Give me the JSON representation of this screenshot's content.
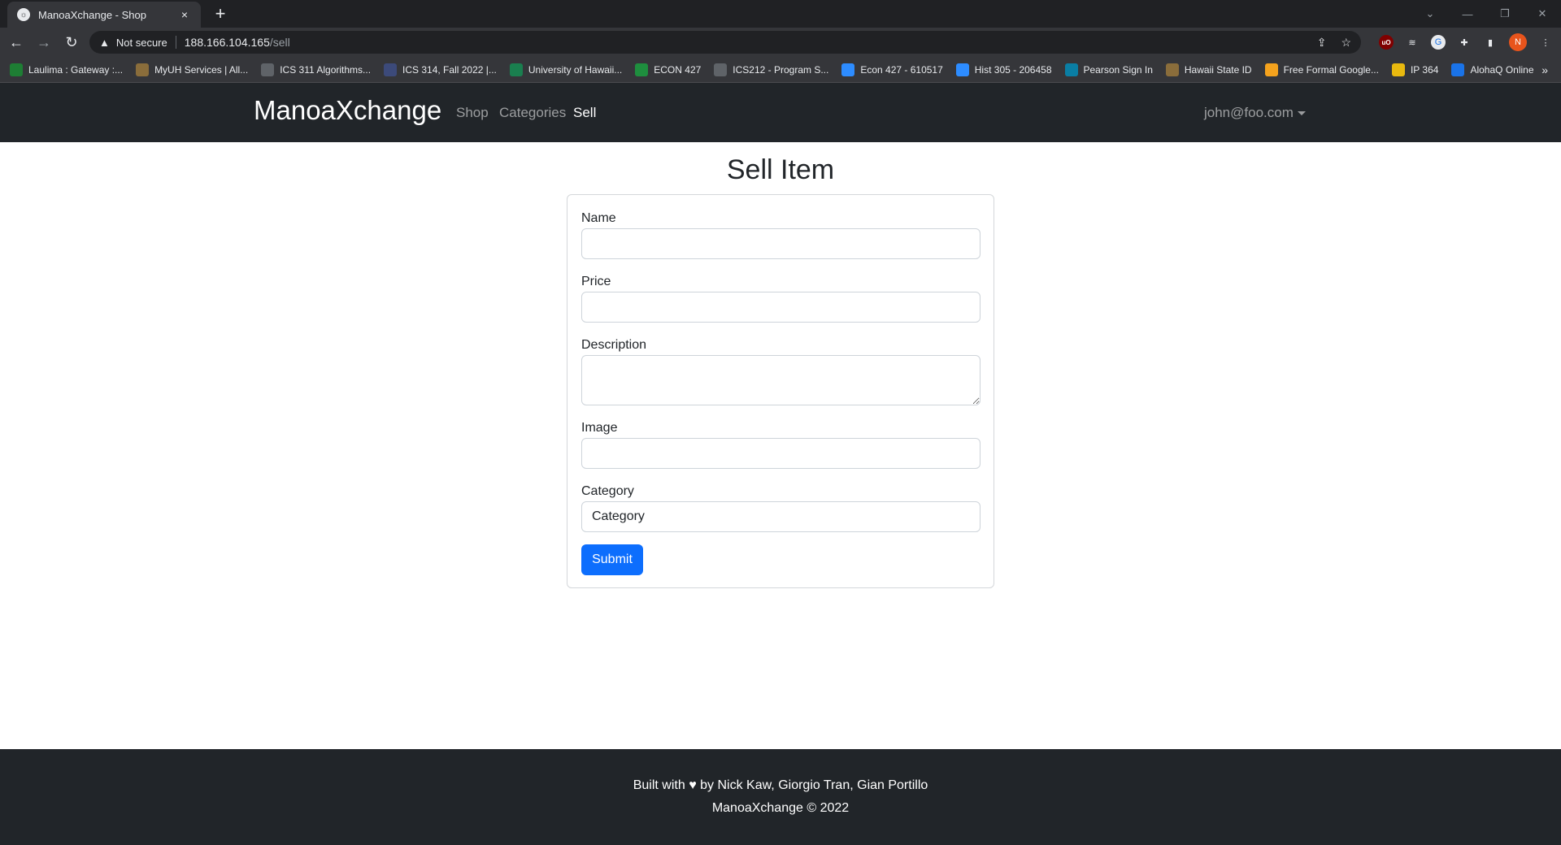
{
  "browser": {
    "tab_title": "ManoaXchange - Shop",
    "tab_close": "×",
    "new_tab": "+",
    "not_secure": "Not secure",
    "url_host": "188.166.104.165",
    "url_path": "/sell",
    "profile_initial": "N",
    "bookmarks": [
      {
        "label": "Laulima : Gateway :...",
        "icon": "laulima-icon",
        "color": "#1e7e34"
      },
      {
        "label": "MyUH Services | All...",
        "icon": "uh-icon",
        "color": "#8a6d3b"
      },
      {
        "label": "ICS 311 Algorithms...",
        "icon": "globe-icon",
        "color": "#5f6368"
      },
      {
        "label": "ICS 314, Fall 2022 |...",
        "icon": "page-icon",
        "color": "#3c4a7a"
      },
      {
        "label": "University of Hawaii...",
        "icon": "uh-seal-icon",
        "color": "#1a7f4f"
      },
      {
        "label": "ECON 427",
        "icon": "classroom-icon",
        "color": "#1e8e3e"
      },
      {
        "label": "ICS212 - Program S...",
        "icon": "globe-icon",
        "color": "#5f6368"
      },
      {
        "label": "Econ 427 - 610517",
        "icon": "zoom-icon",
        "color": "#2d8cff"
      },
      {
        "label": "Hist 305 - 206458",
        "icon": "zoom-icon",
        "color": "#2d8cff"
      },
      {
        "label": "Pearson Sign In",
        "icon": "pearson-icon",
        "color": "#0a7ea4"
      },
      {
        "label": "Hawaii State ID",
        "icon": "seal-icon",
        "color": "#8a6d3b"
      },
      {
        "label": "Free Formal Google...",
        "icon": "bookmark-icon",
        "color": "#f4a21d"
      },
      {
        "label": "IP 364",
        "icon": "classroom-icon",
        "color": "#e8b90f"
      },
      {
        "label": "AlohaQ Online",
        "icon": "search-icon",
        "color": "#1a73e8"
      }
    ]
  },
  "nav": {
    "brand": "ManoaXchange",
    "links": [
      "Shop",
      "Categories",
      "Sell"
    ],
    "user": "john@foo.com"
  },
  "form": {
    "title": "Sell Item",
    "name_label": "Name",
    "price_label": "Price",
    "description_label": "Description",
    "image_label": "Image",
    "category_label": "Category",
    "category_value": "Category",
    "submit_label": "Submit"
  },
  "footer": {
    "built_with": "Built with",
    "heart": "♥",
    "authors": "by Nick Kaw,  Giorgio Tran,  Gian Portillo",
    "copyright": "ManoaXchange © 2022"
  }
}
